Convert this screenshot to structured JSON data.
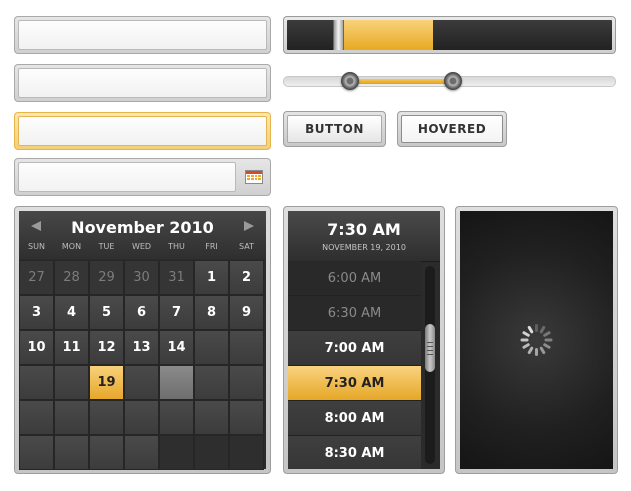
{
  "inputs": [
    {
      "value": "",
      "placeholder": "",
      "state": "normal"
    },
    {
      "value": "",
      "placeholder": "",
      "state": "normal"
    },
    {
      "value": "",
      "placeholder": "",
      "state": "focused"
    },
    {
      "value": "",
      "placeholder": "",
      "state": "date-picker"
    }
  ],
  "progress": {
    "fill_start": 0.17,
    "fill_end": 0.45
  },
  "range_slider": {
    "low": 0.2,
    "high": 0.51
  },
  "buttons": {
    "button_label": "BUTTON",
    "hovered_label": "HOVERED"
  },
  "calendar": {
    "title": "November 2010",
    "weekdays": [
      "SUN",
      "MON",
      "TUE",
      "WED",
      "THU",
      "FRI",
      "SAT"
    ],
    "selected_day": "19",
    "prev_icon": "chevron-left-icon",
    "next_icon": "chevron-right-icon",
    "weeks": [
      [
        "27",
        "28",
        "29",
        "30",
        "31",
        "1",
        "2"
      ],
      [
        "3",
        "4",
        "5",
        "6",
        "7",
        "8",
        "9"
      ],
      [
        "10",
        "11",
        "12",
        "13",
        "14",
        "",
        ""
      ],
      [
        "",
        "",
        "19",
        "",
        "",
        "",
        ""
      ],
      [
        "",
        "",
        "",
        "",
        "",
        "",
        ""
      ],
      [
        "",
        "",
        "",
        "",
        "",
        "",
        ""
      ]
    ]
  },
  "time_picker": {
    "time": "7:30 AM",
    "date": "NOVEMBER 19, 2010",
    "items": [
      "6:00 AM",
      "6:30 AM",
      "7:00 AM",
      "7:30 AM",
      "8:00 AM",
      "8:30 AM"
    ],
    "selected": "7:30 AM"
  },
  "loading": {
    "icon": "spinner-icon"
  },
  "colors": {
    "accent": "#f0bd45",
    "dark": "#2b2b2b"
  }
}
